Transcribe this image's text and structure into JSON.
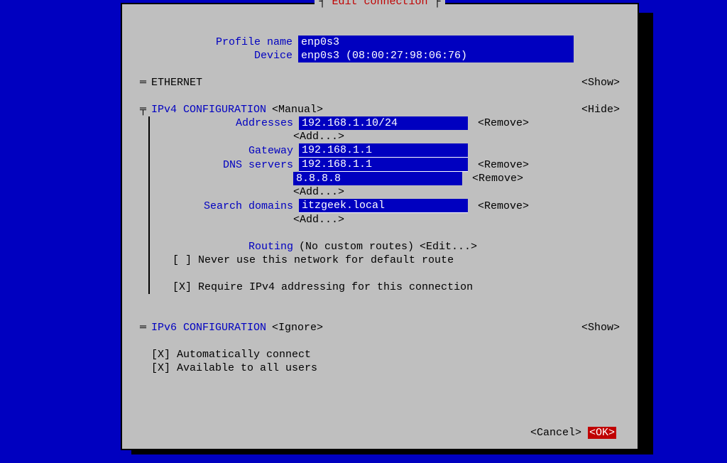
{
  "title": "Edit connection",
  "profile": {
    "name_label": "Profile name",
    "name_value": "enp0s3",
    "device_label": "Device",
    "device_value": "enp0s3 (08:00:27:98:06:76)"
  },
  "ethernet": {
    "label": "ETHERNET",
    "toggle": "<Show>"
  },
  "ipv4": {
    "label": "IPv4 CONFIGURATION",
    "mode": "<Manual>",
    "toggle": "<Hide>",
    "addresses_label": "Addresses",
    "addresses": [
      "192.168.1.10/24"
    ],
    "gateway_label": "Gateway",
    "gateway": "192.168.1.1",
    "dns_label": "DNS servers",
    "dns": [
      "192.168.1.1",
      "8.8.8.8"
    ],
    "search_label": "Search domains",
    "search": [
      "itzgeek.local"
    ],
    "routing_label": "Routing",
    "routing_text": "(No custom routes)",
    "routing_edit": "<Edit...>",
    "never_default": "[ ] Never use this network for default route",
    "require": "[X] Require IPv4 addressing for this connection"
  },
  "ipv6": {
    "label": "IPv6 CONFIGURATION",
    "mode": "<Ignore>",
    "toggle": "<Show>"
  },
  "auto_connect": "[X] Automatically connect",
  "all_users": "[X] Available to all users",
  "actions": {
    "remove": "<Remove>",
    "add": "<Add...>",
    "cancel": "<Cancel>",
    "ok": "<OK>"
  }
}
